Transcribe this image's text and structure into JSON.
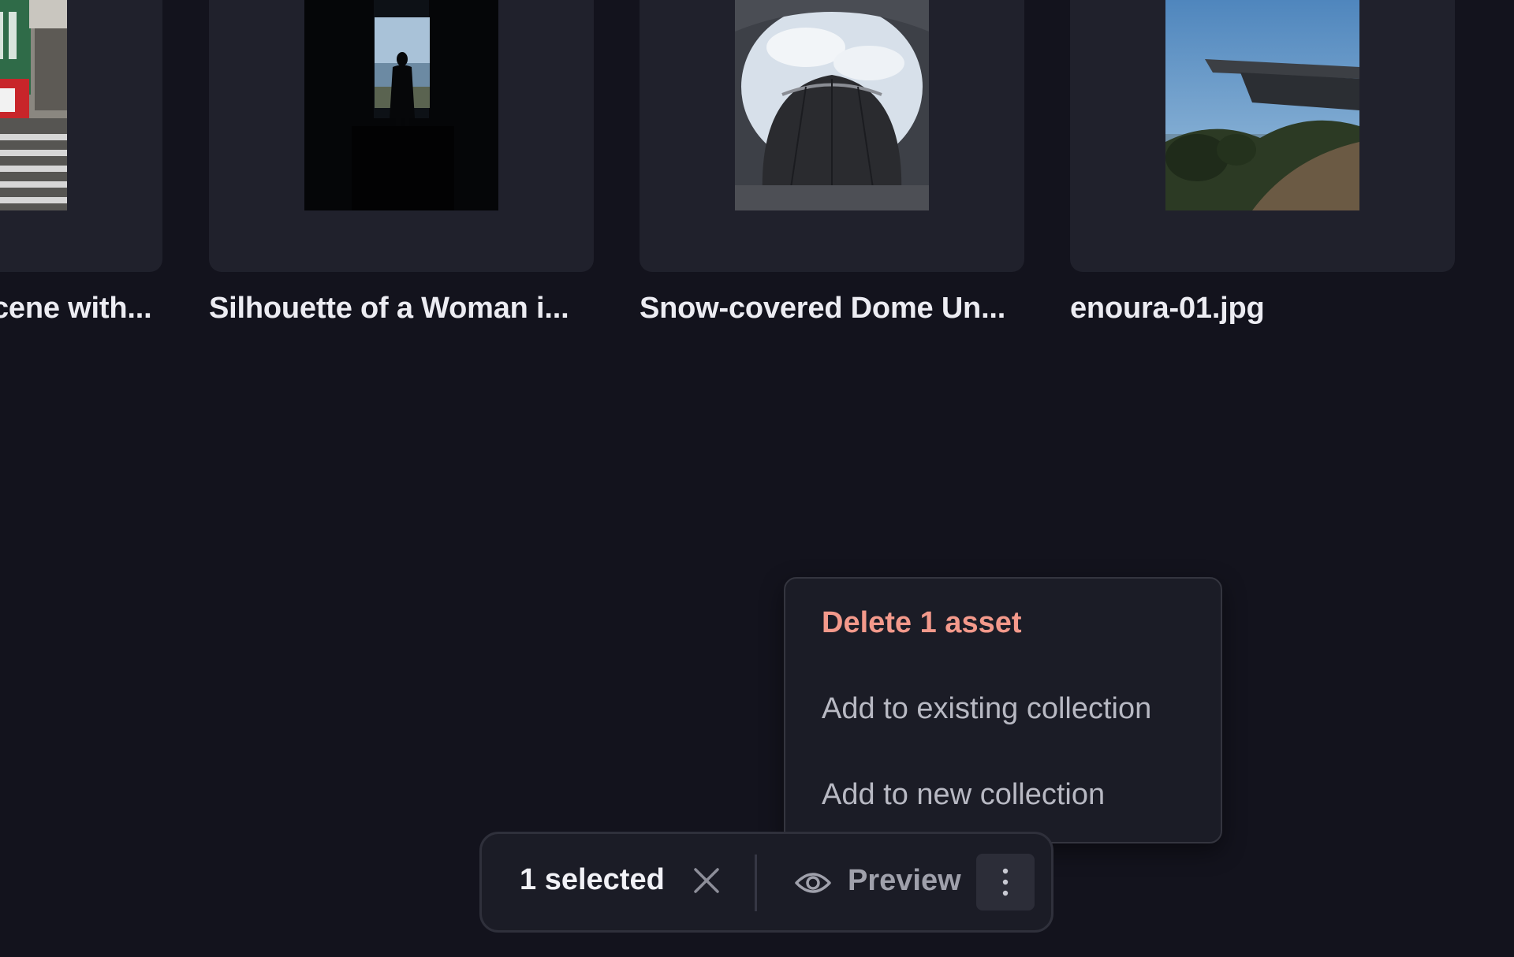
{
  "assets": [
    {
      "title": "cene with...",
      "image": "street-scene-thumbnail"
    },
    {
      "title": "Silhouette of a Woman i...",
      "image": "silhouette-doorway-thumbnail"
    },
    {
      "title": "Snow-covered Dome Un...",
      "image": "snow-dome-thumbnail"
    },
    {
      "title": "enoura-01.jpg",
      "image": "cantilever-building-thumbnail"
    }
  ],
  "menu": {
    "items": [
      {
        "label": "Delete 1 asset",
        "variant": "danger"
      },
      {
        "label": "Add to existing collection",
        "variant": "default"
      },
      {
        "label": "Add to new collection",
        "variant": "default"
      }
    ]
  },
  "selection_bar": {
    "count_label": "1 selected",
    "clear_icon": "close-icon",
    "preview_label": "Preview",
    "preview_icon": "eye-icon",
    "more_icon": "more-vertical-icon"
  },
  "colors": {
    "background": "#13131d",
    "card": "#20212c",
    "danger": "#f3998b",
    "menu_text": "#b8b9c3"
  }
}
